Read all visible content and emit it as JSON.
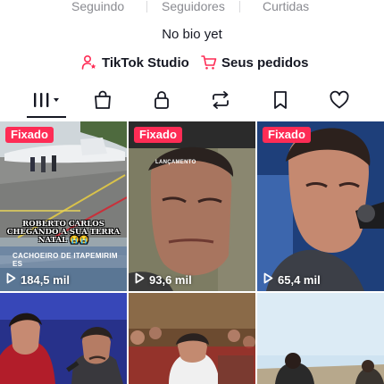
{
  "stats": {
    "following_label": "Seguindo",
    "followers_label": "Seguidores",
    "likes_label": "Curtidas"
  },
  "bio": "No bio yet",
  "links": {
    "studio_label": "TikTok Studio",
    "orders_label": "Seus pedidos"
  },
  "tabs": [
    {
      "name": "videos",
      "icon": "grid-bars-icon",
      "selected": true
    },
    {
      "name": "shop",
      "icon": "shopping-bag-icon"
    },
    {
      "name": "private",
      "icon": "lock-icon"
    },
    {
      "name": "reposts",
      "icon": "repost-icon"
    },
    {
      "name": "favorites",
      "icon": "bookmark-icon"
    },
    {
      "name": "liked",
      "icon": "heart-icon"
    }
  ],
  "videos": [
    {
      "pinned_label": "Fixado",
      "views": "184,5 mil",
      "caption": "ROBERTO CARLOS CHEGANDO A SUA TERRA NATAL 😭😭",
      "location": "CACHOEIRO DE ITAPEMIRIM ES"
    },
    {
      "pinned_label": "Fixado",
      "views": "93,6 mil",
      "tag": "LANÇAMENTO"
    },
    {
      "pinned_label": "Fixado",
      "views": "65,4 mil"
    },
    {},
    {},
    {}
  ],
  "colors": {
    "accent": "#fe2c55",
    "text": "#161823",
    "muted": "#8a8b91"
  }
}
